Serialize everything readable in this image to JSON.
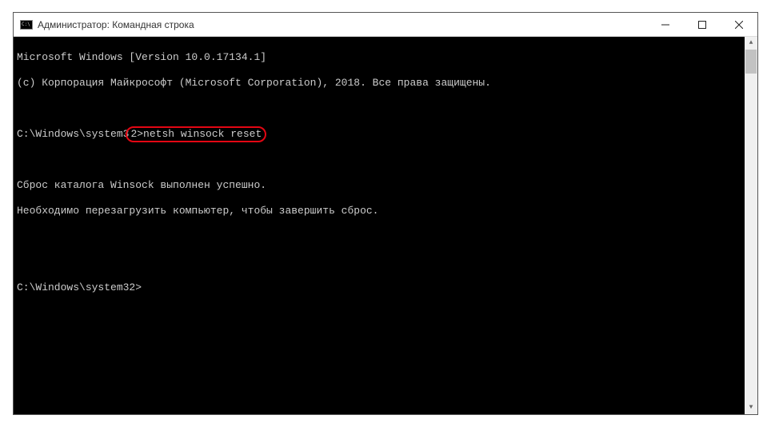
{
  "window": {
    "title": "Администратор: Командная строка"
  },
  "console": {
    "line1": "Microsoft Windows [Version 10.0.17134.1]",
    "line2": "(c) Корпорация Майкрософт (Microsoft Corporation), 2018. Все права защищены.",
    "prompt1_prefix": "C:\\Windows\\system3",
    "prompt1_highlight": "2>netsh winsock reset",
    "result1": "Сброс каталога Winsock выполнен успешно.",
    "result2": "Необходимо перезагрузить компьютер, чтобы завершить сброс.",
    "prompt2": "C:\\Windows\\system32>"
  }
}
